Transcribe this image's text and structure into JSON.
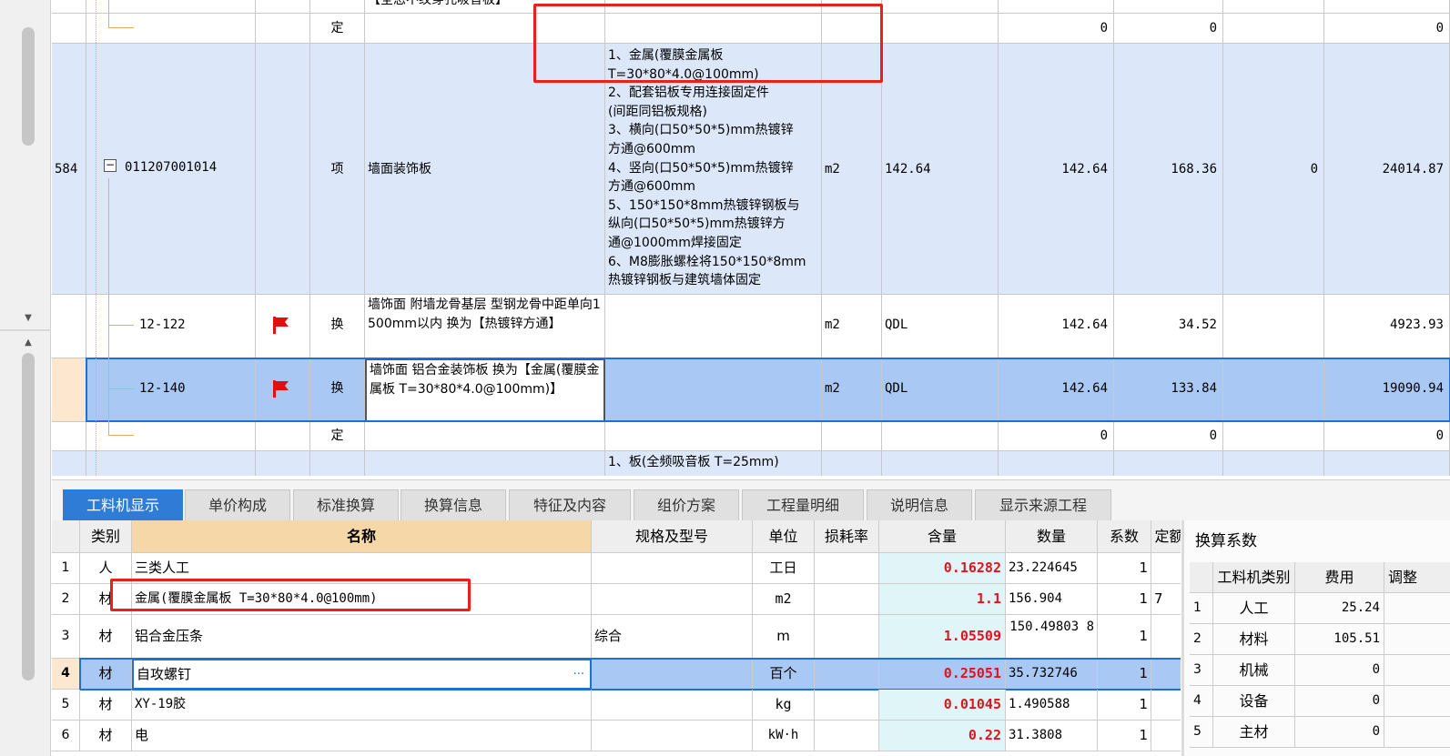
{
  "upper_grid": {
    "rows": [
      {
        "code": "",
        "type": "定",
        "name": "",
        "feature": "",
        "unit": "",
        "expr": "",
        "qty": "0",
        "price": "0",
        "c9": "",
        "total": "0"
      },
      {
        "rownum": "584",
        "code": "011207001014",
        "type": "项",
        "name": "墙面装饰板",
        "feature_lines": [
          "1、金属(覆膜金属板",
          "T=30*80*4.0@100mm)",
          "2、配套铝板专用连接固定件",
          "(间距同铝板规格)",
          "3、横向(口50*50*5)mm热镀锌",
          "方通@600mm",
          "4、竖向(口50*50*5)mm热镀锌",
          "方通@600mm",
          "5、150*150*8mm热镀锌钢板与",
          "纵向(口50*50*5)mm热镀锌方",
          "通@1000mm焊接固定",
          "6、M8膨胀螺栓将150*150*8mm",
          "热镀锌钢板与建筑墙体固定"
        ],
        "unit": "m2",
        "expr": "142.64",
        "qty": "142.64",
        "price": "168.36",
        "c9": "0",
        "total": "24014.87"
      },
      {
        "code": "12-122",
        "type": "换",
        "name": "墙饰面 附墙龙骨基层 型钢龙骨中距单向1500mm以内  换为【热镀锌方通】",
        "unit": "m2",
        "expr": "QDL",
        "qty": "142.64",
        "price": "34.52",
        "c9": "",
        "total": "4923.93"
      },
      {
        "code": "12-140",
        "type": "换",
        "name": "墙饰面 铝合金装饰板  换为【金属(覆膜金属板 T=30*80*4.0@100mm)】",
        "unit": "m2",
        "expr": "QDL",
        "qty": "142.64",
        "price": "133.84",
        "c9": "",
        "total": "19090.94"
      },
      {
        "code": "",
        "type": "定",
        "name": "",
        "unit": "",
        "expr": "",
        "qty": "0",
        "price": "0",
        "c9": "",
        "total": "0"
      },
      {
        "code": "",
        "type": "",
        "name": "",
        "feature_lines": [
          "1、板(全频吸音板 T=25mm)"
        ],
        "unit": "",
        "expr": "",
        "qty": "",
        "price": "",
        "c9": "",
        "total": ""
      }
    ],
    "top_partial_text": "【全态不纹穿孔吸音板】"
  },
  "tabs": [
    "工料机显示",
    "单价构成",
    "标准换算",
    "换算信息",
    "特征及内容",
    "组价方案",
    "工程量明细",
    "说明信息",
    "显示来源工程"
  ],
  "active_tab": 0,
  "lower_grid": {
    "headers": [
      "类别",
      "名称",
      "规格及型号",
      "单位",
      "损耗率",
      "含量",
      "数量",
      "系数",
      "定额"
    ],
    "rows": [
      {
        "n": "1",
        "cat": "人",
        "name": "三类人工",
        "spec": "",
        "unit": "工日",
        "loss": "",
        "content": "0.16282",
        "qty": "23.224645",
        "coef": "1",
        "extra": ""
      },
      {
        "n": "2",
        "cat": "材",
        "name": "金属(覆膜金属板 T=30*80*4.0@100mm)",
        "spec": "",
        "unit": "m2",
        "loss": "",
        "content": "1.1",
        "qty": "156.904",
        "coef": "1",
        "extra": "7"
      },
      {
        "n": "3",
        "cat": "材",
        "name": "铝合金压条",
        "spec": "综合",
        "unit": "m",
        "loss": "",
        "content": "1.05509",
        "qty": "150.49803 8",
        "coef": "1",
        "extra": ""
      },
      {
        "n": "4",
        "cat": "材",
        "name": "自攻螺钉",
        "spec": "",
        "unit": "百个",
        "loss": "",
        "content": "0.25051",
        "qty": "35.732746",
        "coef": "1",
        "extra": ""
      },
      {
        "n": "5",
        "cat": "材",
        "name": "XY-19胶",
        "spec": "",
        "unit": "kg",
        "loss": "",
        "content": "0.01045",
        "qty": "1.490588",
        "coef": "1",
        "extra": ""
      },
      {
        "n": "6",
        "cat": "材",
        "name": "电",
        "spec": "",
        "unit": "kW·h",
        "loss": "",
        "content": "0.22",
        "qty": "31.3808",
        "coef": "1",
        "extra": ""
      }
    ],
    "more_glyph": "···"
  },
  "right_panel": {
    "title": "换算系数",
    "headers": [
      "工料机类别",
      "费用",
      "调整"
    ],
    "rows": [
      {
        "n": "1",
        "cat": "人工",
        "fee": "25.24"
      },
      {
        "n": "2",
        "cat": "材料",
        "fee": "105.51"
      },
      {
        "n": "3",
        "cat": "机械",
        "fee": "0"
      },
      {
        "n": "4",
        "cat": "设备",
        "fee": "0"
      },
      {
        "n": "5",
        "cat": "主材",
        "fee": "0"
      }
    ]
  },
  "colors": {
    "accent": "#2f7cd6",
    "highlight_red": "#e8211c",
    "row_blue": "#dce8fa",
    "selected": "#a9c8f3",
    "content_red": "#e0141e"
  },
  "icons": [
    "flag-icon",
    "expand-minus-icon",
    "scroll-up-arrow",
    "scroll-down-arrow",
    "more-icon"
  ]
}
